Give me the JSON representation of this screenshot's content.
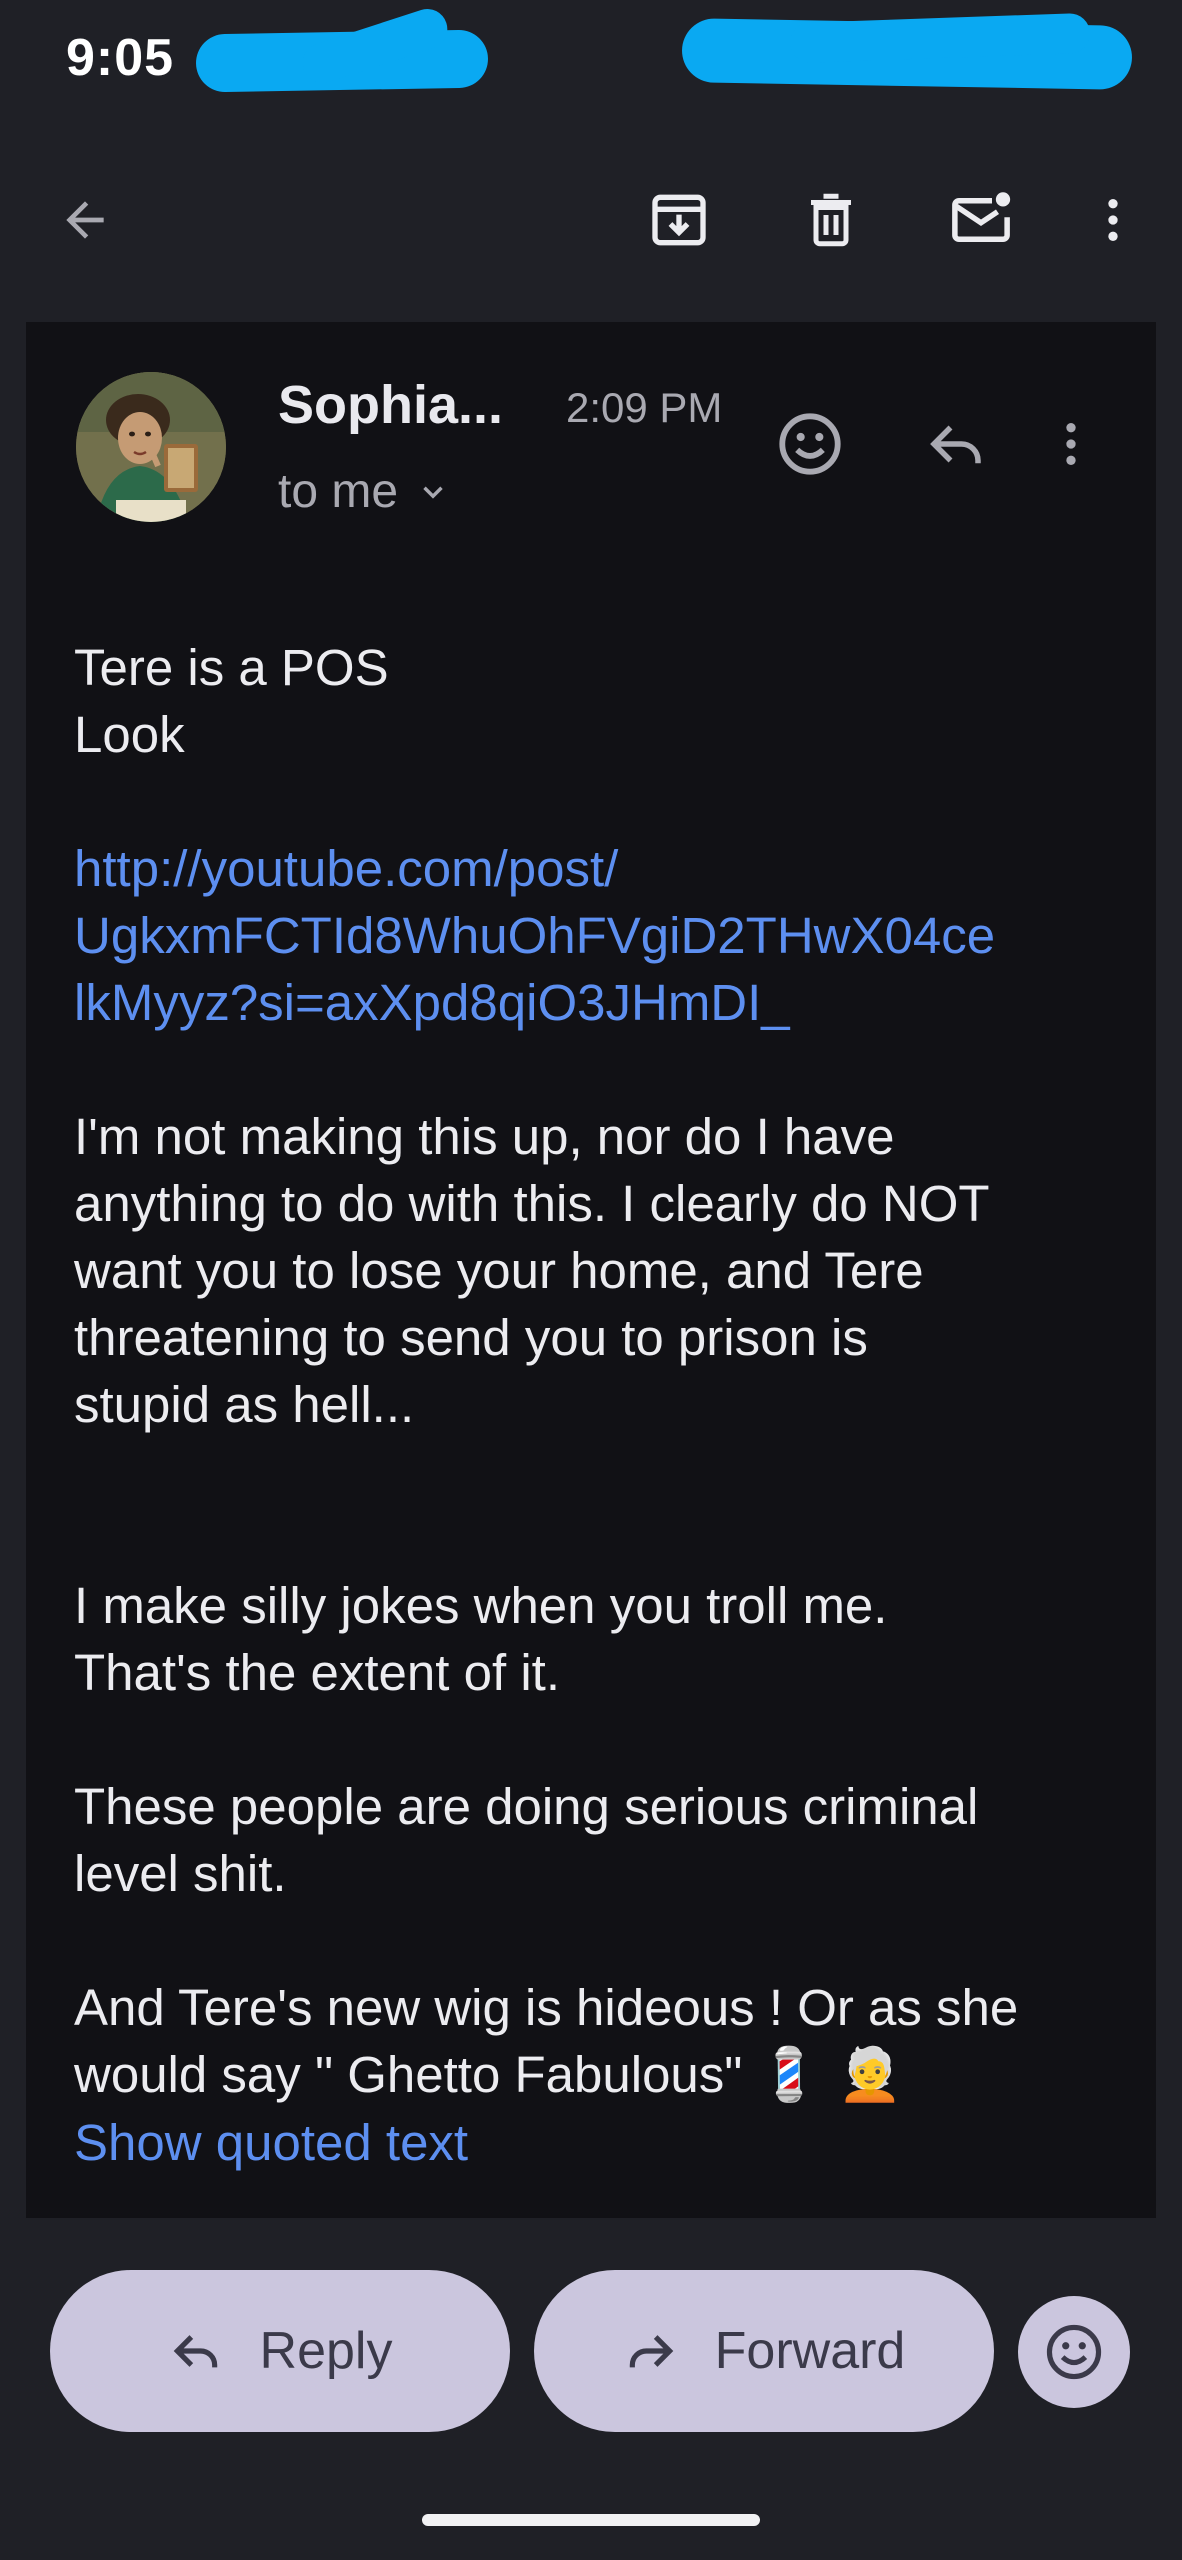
{
  "status_bar": {
    "time": "9:05"
  },
  "toolbar": {
    "back_icon": "arrow-back-icon",
    "archive_icon": "archive-icon",
    "delete_icon": "trash-icon",
    "mark_unread_icon": "mail-unread-icon",
    "more_icon": "more-vert-icon"
  },
  "message": {
    "sender": "Sophia...",
    "time": "2:09 PM",
    "recipient": "to me",
    "body": {
      "line1": "Tere is a POS",
      "line2": "Look",
      "link_line1": "http://youtube.com/post/",
      "link_line2": "UgkxmFCTId8WhuOhFVgiD2THwX04ce",
      "link_line3": "lkMyyz?si=axXpd8qiO3JHmDI_",
      "para1_line1": "I'm not making this up, nor do I have",
      "para1_line2": "anything to do with this. I clearly do NOT",
      "para1_line3": "want you to lose your home, and Tere",
      "para1_line4": "threatening to send you to prison is",
      "para1_line5": "stupid as hell...",
      "para2_line1": "I make silly jokes when you troll me.",
      "para2_line2": "That's the extent of it.",
      "para3_line1": "These people are doing serious criminal",
      "para3_line2": "level shit.",
      "para4_line1": "And Tere's new wig is hideous ! Or as she",
      "para4_line2": "would say \" Ghetto Fabulous\"",
      "para4_emoji": "💈 🧑‍🦳"
    },
    "show_quoted": "Show quoted text"
  },
  "actions": {
    "reply_label": "Reply",
    "forward_label": "Forward"
  },
  "colors": {
    "background": "#1f2026",
    "card": "#111115",
    "link": "#5d8ff0",
    "pill": "#cbc6de",
    "redaction": "#0aa9f2"
  }
}
